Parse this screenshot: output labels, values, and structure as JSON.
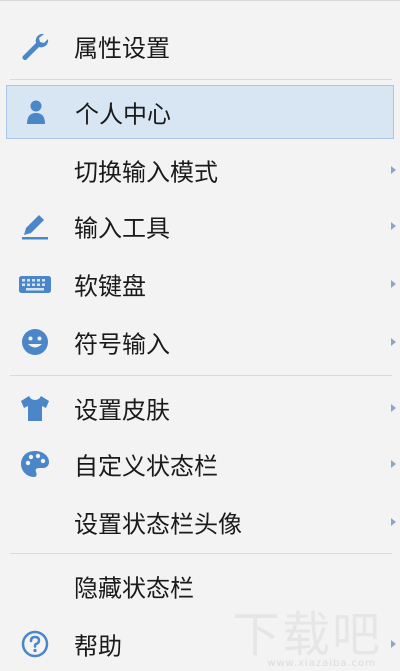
{
  "menu": {
    "items": [
      {
        "label": "属性设置",
        "icon": "wrench-icon",
        "submenu": false
      },
      {
        "label": "个人中心",
        "icon": "user-icon",
        "submenu": false,
        "hover": true
      },
      {
        "label": "切换输入模式",
        "icon": "",
        "submenu": true
      },
      {
        "label": "输入工具",
        "icon": "pencil-icon",
        "submenu": true
      },
      {
        "label": "软键盘",
        "icon": "keyboard-icon",
        "submenu": true
      },
      {
        "label": "符号输入",
        "icon": "smiley-icon",
        "submenu": true
      },
      {
        "label": "设置皮肤",
        "icon": "shirt-icon",
        "submenu": true
      },
      {
        "label": "自定义状态栏",
        "icon": "palette-icon",
        "submenu": true
      },
      {
        "label": "设置状态栏头像",
        "icon": "",
        "submenu": true
      },
      {
        "label": "隐藏状态栏",
        "icon": "",
        "submenu": false
      },
      {
        "label": "帮助",
        "icon": "help-icon",
        "submenu": true
      }
    ]
  },
  "colors": {
    "icon_blue": "#4a86c8",
    "hover_bg": "#d8e6f4",
    "hover_border": "#a9c6e6"
  },
  "watermark": {
    "text": "下载吧",
    "sub": "www.xiazaiba.com"
  }
}
